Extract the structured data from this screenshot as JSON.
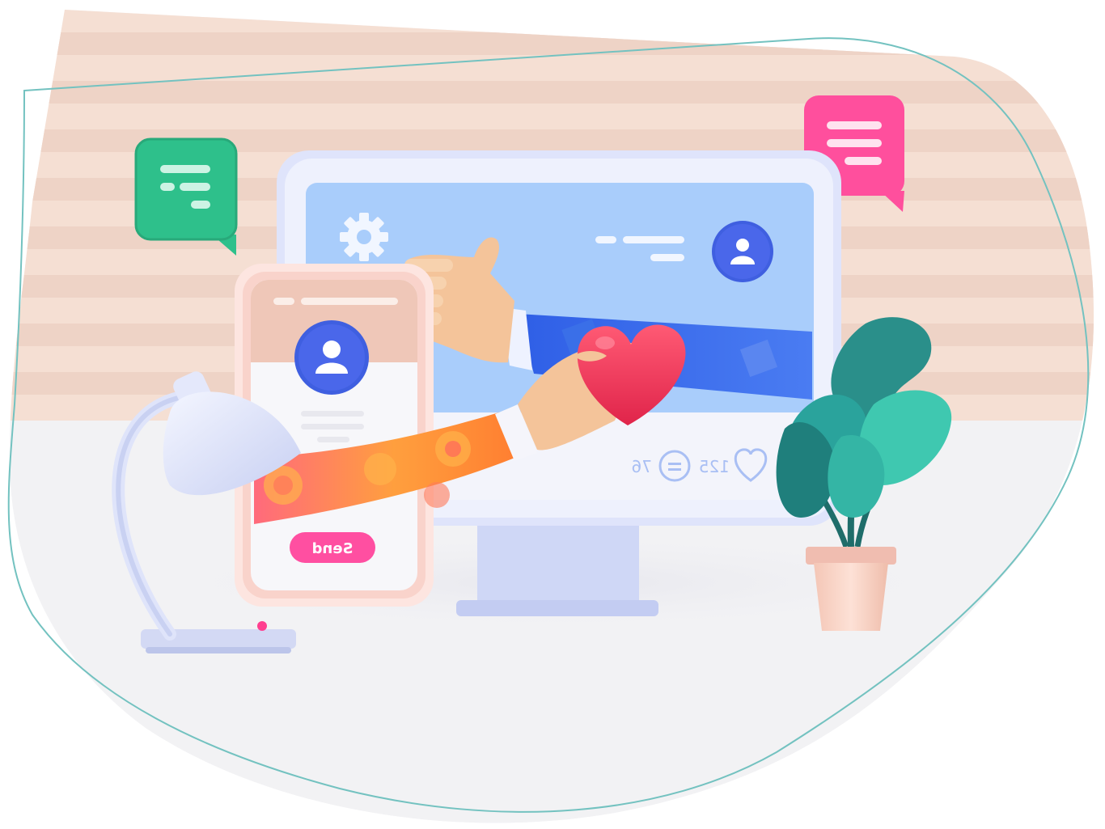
{
  "illustration": {
    "phone": {
      "send_button_label": "Send"
    },
    "monitor": {
      "likes_count": "125",
      "comments_count": "76"
    }
  },
  "icons": [
    "gear-icon",
    "user-avatar-icon",
    "heart-outline-icon",
    "comment-bubble-icon",
    "chat-bubble-icon"
  ],
  "colors": {
    "stripe_pink": "#efd2c4",
    "frame_outline": "#73c2c0",
    "monitor_screen": "#a9cdfb",
    "monitor_frame": "#dfe4fb",
    "chat_green": "#2ec08b",
    "chat_pink": "#ff4f9d",
    "avatar_blue": "#3f5fe0",
    "heart_red": "#f23b5c",
    "send_button": "#ff4fa1",
    "plant_teal": "#2aa39c",
    "pot_pink": "#f6cbbd"
  }
}
